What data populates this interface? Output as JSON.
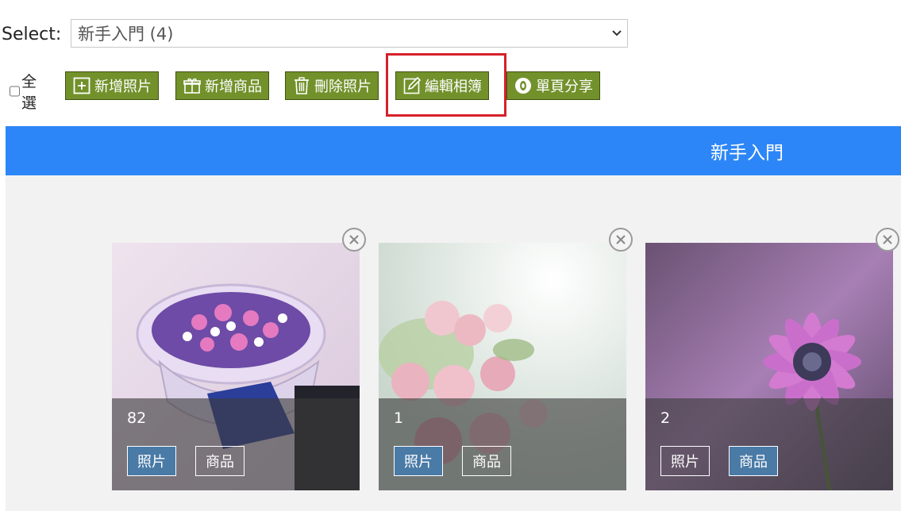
{
  "select": {
    "label": "Select:",
    "value": "新手入門 (4)"
  },
  "toolbar": {
    "select_all_label": "全選",
    "buttons": [
      {
        "label": "新增照片",
        "icon": "plus-square-icon"
      },
      {
        "label": "新增商品",
        "icon": "gift-icon"
      },
      {
        "label": "刪除照片",
        "icon": "trash-icon"
      },
      {
        "label": "編輯相簿",
        "icon": "pencil-edit-icon"
      },
      {
        "label": "單頁分享",
        "icon": "eye-icon"
      }
    ]
  },
  "album": {
    "title": "新手入門",
    "cards": [
      {
        "count": "82",
        "photo_label": "照片",
        "product_label": "商品",
        "active": "photo"
      },
      {
        "count": "1",
        "photo_label": "照片",
        "product_label": "商品",
        "active": "photo"
      },
      {
        "count": "2",
        "photo_label": "照片",
        "product_label": "商品",
        "active": "product"
      }
    ]
  },
  "colors": {
    "toolbar_button": "#72912b",
    "header": "#2d86f7",
    "highlight": "#d6202a",
    "active_tag": "#4a7aa6"
  }
}
